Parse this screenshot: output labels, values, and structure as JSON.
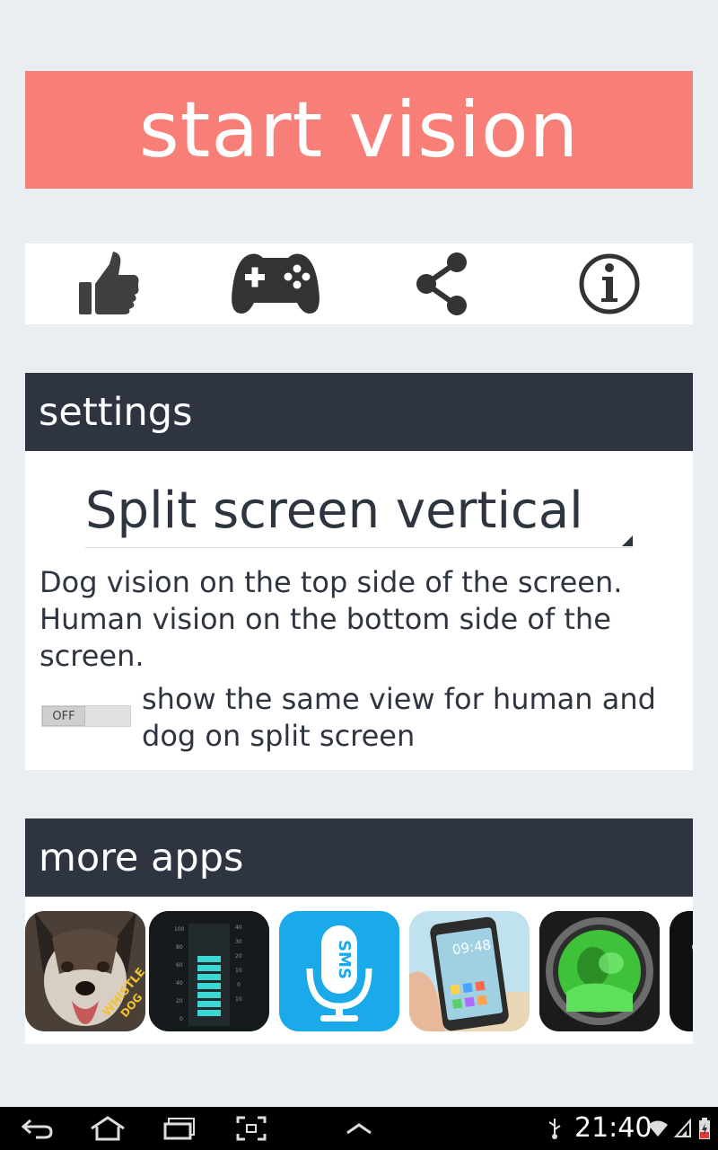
{
  "start_button": {
    "label": "start vision"
  },
  "toolbar": {
    "icons": [
      "thumbs-up-icon",
      "gamepad-icon",
      "share-icon",
      "info-icon"
    ]
  },
  "settings": {
    "header": "settings",
    "mode_select": {
      "value": "Split screen vertical"
    },
    "description": "Dog vision on the top side of the screen. Human vision on the bottom side of the screen.",
    "toggle": {
      "state": "OFF",
      "label": "show the same view for human and dog on split screen"
    }
  },
  "more_apps": {
    "header": "more apps",
    "apps": [
      {
        "name": "whistle-for-dog-app-icon",
        "caption": "WHISTLE FOR DOG"
      },
      {
        "name": "level-meter-app-icon"
      },
      {
        "name": "sms-voice-app-icon",
        "caption": "SMS"
      },
      {
        "name": "transparent-screen-app-icon",
        "caption": "09:48"
      },
      {
        "name": "night-vision-app-icon"
      },
      {
        "name": "partial-app-icon"
      }
    ]
  },
  "status_bar": {
    "time": "21:40"
  },
  "colors": {
    "accent": "#f87f77",
    "header": "#2e3440",
    "background": "#e8eef2"
  }
}
